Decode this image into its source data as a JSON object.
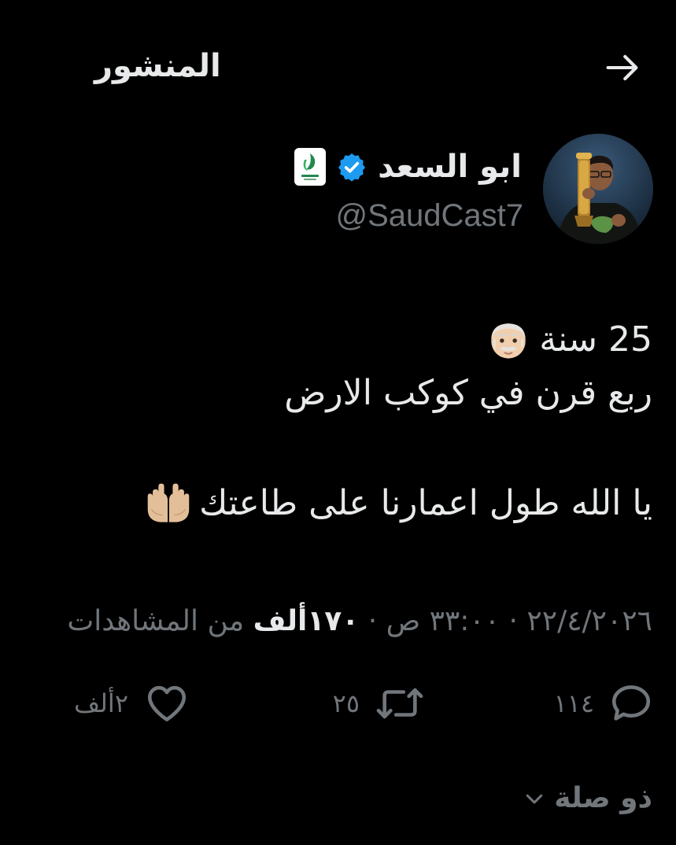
{
  "header": {
    "title": "المنشور",
    "back_icon": "arrow-back-icon"
  },
  "author": {
    "display_name": "ابو السعد",
    "handle": "@SaudCast7",
    "verified_icon": "verified-badge-icon",
    "affiliate_icon": "affiliate-badge-icon",
    "avatar_icon": "avatar-photo"
  },
  "post": {
    "line1": "25 سنة",
    "line1_emoji": "old-man-emoji",
    "line2": "ربع قرن في كوكب الارض",
    "line3": "يا الله طول اعمارنا على طاعتك",
    "line3_emoji": "palms-up-together-emoji"
  },
  "meta": {
    "date_time": "٢٢/٤/٢٠٢٦ · ٣٣:٠٠ ص ·",
    "views_count": "١٧٠ألف",
    "views_label": "من المشاهدات"
  },
  "actions": {
    "replies": "١١٤",
    "reposts": "٢٥",
    "likes": "٢ألف"
  },
  "related": {
    "label": "ذو صلة"
  },
  "colors": {
    "background": "#000000",
    "text": "#e7e9ea",
    "muted": "#71767b",
    "verified": "#1d9bf0"
  }
}
